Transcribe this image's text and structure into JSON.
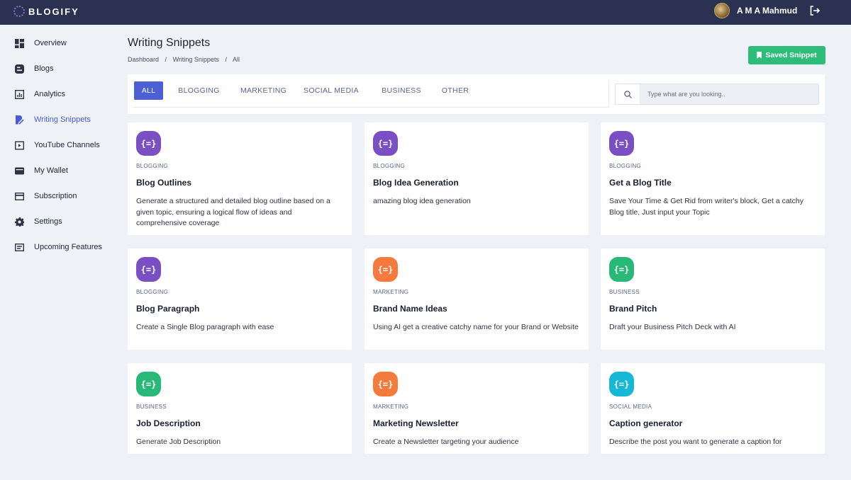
{
  "app": {
    "name": "BLOGIFY"
  },
  "user": {
    "name": "A M A Mahmud"
  },
  "sidebar": {
    "items": [
      {
        "label": "Overview",
        "icon": "dashboard-icon"
      },
      {
        "label": "Blogs",
        "icon": "blog-icon"
      },
      {
        "label": "Analytics",
        "icon": "analytics-icon"
      },
      {
        "label": "Writing Snippets",
        "icon": "edit-icon",
        "active": true
      },
      {
        "label": "YouTube Channels",
        "icon": "youtube-icon"
      },
      {
        "label": "My Wallet",
        "icon": "wallet-icon"
      },
      {
        "label": "Subscription",
        "icon": "card-icon"
      },
      {
        "label": "Settings",
        "icon": "gear-icon"
      },
      {
        "label": "Upcoming Features",
        "icon": "features-icon"
      }
    ]
  },
  "page": {
    "title": "Writing Snippets",
    "breadcrumb": [
      "Dashboard",
      "/",
      "Writing Snippets",
      "/",
      "All"
    ],
    "saved_button": "Saved Snippet"
  },
  "tabs": [
    "ALL",
    "BLOGGING",
    "MARKETING",
    "SOCIAL MEDIA",
    "BUSINESS",
    "OTHER"
  ],
  "search": {
    "placeholder": "Type what are you looking.."
  },
  "colors": {
    "accent": "#4c5fd5",
    "success": "#2dbd78",
    "blogging": "#7b4fc4",
    "marketing": "#f47a3d",
    "business": "#28b877",
    "social": "#17b7d6"
  },
  "icon_glyph": "{=}",
  "cards": [
    {
      "category": "BLOGGING",
      "title": "Blog Outlines",
      "desc": "Generate a structured and detailed blog outline based on a given topic, ensuring a logical flow of ideas and comprehensive coverage",
      "color": "#7b4fc4"
    },
    {
      "category": "BLOGGING",
      "title": "Blog Idea Generation",
      "desc": "amazing blog idea generation",
      "color": "#7b4fc4"
    },
    {
      "category": "BLOGGING",
      "title": "Get a Blog Title",
      "desc": "Save Your Time & Get Rid from writer's block, Get a catchy Blog title, Just input your Topic",
      "color": "#7b4fc4"
    },
    {
      "category": "BLOGGING",
      "title": "Blog Paragraph",
      "desc": "Create a Single Blog paragraph with ease",
      "color": "#7b4fc4"
    },
    {
      "category": "MARKETING",
      "title": "Brand Name Ideas",
      "desc": "Using AI get a creative catchy name for your Brand or Website",
      "color": "#f47a3d"
    },
    {
      "category": "BUSINESS",
      "title": "Brand Pitch",
      "desc": "Draft your Business Pitch Deck with AI",
      "color": "#28b877"
    },
    {
      "category": "BUSINESS",
      "title": "Job Description",
      "desc": "Generate Job Description",
      "color": "#28b877"
    },
    {
      "category": "MARKETING",
      "title": "Marketing Newsletter",
      "desc": "Create a Newsletter targeting your audience",
      "color": "#f47a3d"
    },
    {
      "category": "SOCIAL MEDIA",
      "title": "Caption generator",
      "desc": "Describe the post you want to generate a caption for",
      "color": "#17b7d6"
    }
  ]
}
